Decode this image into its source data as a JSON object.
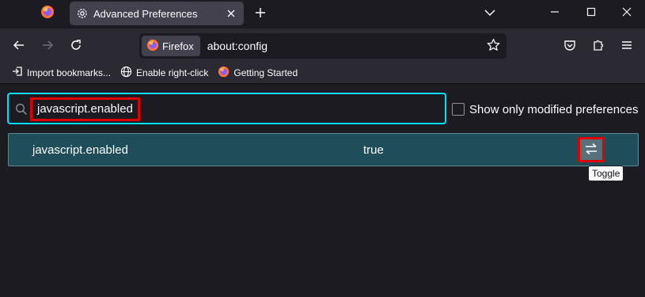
{
  "tab": {
    "title": "Advanced Preferences"
  },
  "urlbar": {
    "identity_label": "Firefox",
    "url": "about:config"
  },
  "bookmarks": [
    {
      "label": "Import bookmarks...",
      "icon": "import-icon"
    },
    {
      "label": "Enable right-click",
      "icon": "globe-icon"
    },
    {
      "label": "Getting Started",
      "icon": "firefox-icon"
    }
  ],
  "config": {
    "search_value": "javascript.enabled",
    "modified_label": "Show only modified preferences",
    "pref_name": "javascript.enabled",
    "pref_value": "true",
    "toggle_tooltip": "Toggle"
  },
  "colors": {
    "accent": "#00ddff",
    "highlight": "#e10000",
    "row_bg": "#1f4e5a"
  }
}
